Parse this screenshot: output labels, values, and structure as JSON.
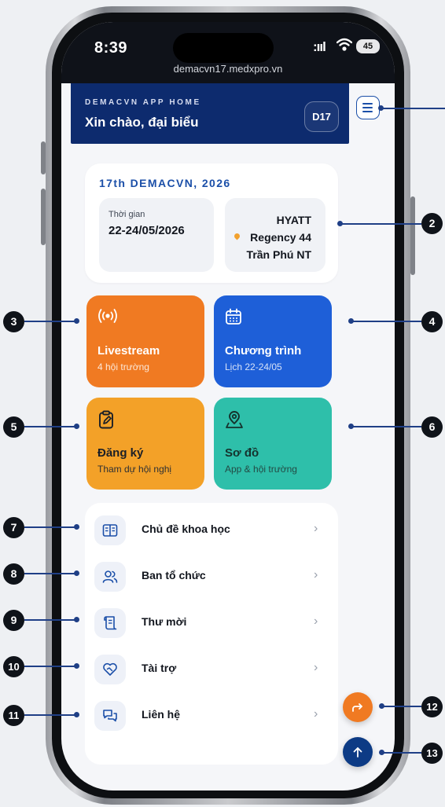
{
  "status_bar": {
    "time": "8:39",
    "signal": ":ııl",
    "battery": "45"
  },
  "browser": {
    "url": "demacvn17.medxpro.vn"
  },
  "header": {
    "kicker": "DEMACVN APP HOME",
    "greeting": "Xin chào, đại biểu",
    "badge": "D17"
  },
  "event": {
    "title": "17th DEMACVN, 2026",
    "time_label": "Thời gian",
    "time_value": "22-24/05/2026",
    "venue_lines": [
      "HYATT",
      "Regency 44",
      "Trần Phú NT"
    ]
  },
  "tiles": [
    {
      "title": "Livestream",
      "subtitle": "4 hội trường",
      "icon": "broadcast-icon",
      "color": "#f07a22"
    },
    {
      "title": "Chương trình",
      "subtitle": "Lịch 22-24/05",
      "icon": "calendar-icon",
      "color": "#1e5fd8"
    },
    {
      "title": "Đăng ký",
      "subtitle": "Tham dự hội nghị",
      "icon": "clipboard-edit-icon",
      "color": "#f3a128"
    },
    {
      "title": "Sơ đồ",
      "subtitle": "App & hội trường",
      "icon": "map-pin-icon",
      "color": "#2ebfaa"
    }
  ],
  "menu_items": [
    {
      "label": "Chủ đề khoa học",
      "icon": "book-open-icon"
    },
    {
      "label": "Ban tổ chức",
      "icon": "users-icon"
    },
    {
      "label": "Thư mời",
      "icon": "scroll-icon"
    },
    {
      "label": "Tài trợ",
      "icon": "heart-handshake-icon"
    },
    {
      "label": "Liên hệ",
      "icon": "chat-icon"
    }
  ],
  "chevron": "›",
  "fabs": {
    "share_icon": "share-icon",
    "share_color": "#f07a22",
    "top_icon": "arrow-up-icon",
    "top_color": "#0d3b85"
  },
  "callouts": [
    "2",
    "3",
    "4",
    "5",
    "6",
    "7",
    "8",
    "9",
    "10",
    "11",
    "12",
    "13"
  ],
  "colors": {
    "navy": "#0d2b6e",
    "accent_blue": "#1b4fa8",
    "background": "#f5f6f9"
  }
}
